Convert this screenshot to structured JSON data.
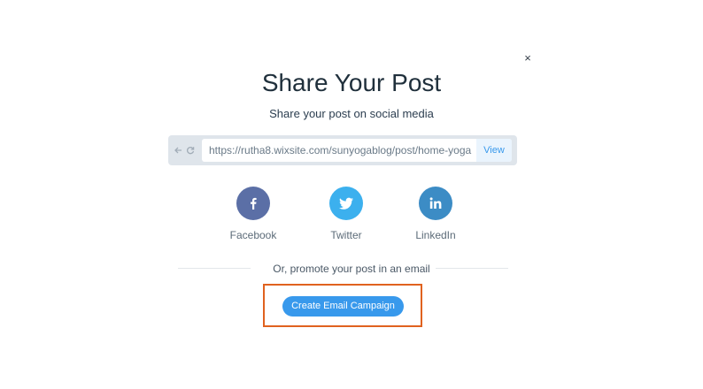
{
  "dialog": {
    "close_symbol": "×",
    "title": "Share Your Post",
    "subtitle": "Share your post on social media"
  },
  "url_bar": {
    "back_icon": "arrow-left-icon",
    "refresh_icon": "refresh-icon",
    "url": "https://rutha8.wixsite.com/sunyogablog/post/home-yoga",
    "view_label": "View"
  },
  "social": [
    {
      "label": "Facebook",
      "icon": "facebook-icon",
      "color": "#5b6fa6"
    },
    {
      "label": "Twitter",
      "icon": "twitter-icon",
      "color": "#3cb0ee"
    },
    {
      "label": "LinkedIn",
      "icon": "linkedin-icon",
      "color": "#3c8cc5"
    }
  ],
  "email": {
    "divider_text": "Or, promote your post in an email",
    "button_label": "Create Email Campaign",
    "highlight_color": "#e0621f"
  },
  "colors": {
    "accent": "#3899ec"
  }
}
